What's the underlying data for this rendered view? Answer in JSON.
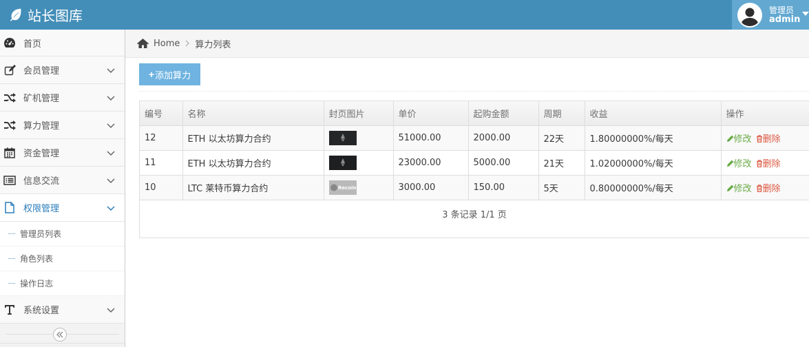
{
  "header": {
    "brand_title": "站长图库",
    "user_role": "管理员",
    "user_name": "admin"
  },
  "sidebar": {
    "items": [
      {
        "label": "首页",
        "icon": "dashboard-icon"
      },
      {
        "label": "会员管理",
        "icon": "edit-icon"
      },
      {
        "label": "矿机管理",
        "icon": "shuffle-icon"
      },
      {
        "label": "算力管理",
        "icon": "shuffle-icon"
      },
      {
        "label": "资金管理",
        "icon": "calendar-icon"
      },
      {
        "label": "信息交流",
        "icon": "list-alt-icon"
      },
      {
        "label": "权限管理",
        "icon": "file-icon"
      },
      {
        "label": "系统设置",
        "icon": "text-t-icon"
      }
    ],
    "sub_items": [
      "管理员列表",
      "角色列表",
      "操作日志"
    ]
  },
  "breadcrumb": {
    "home": "Home",
    "current": "算力列表"
  },
  "toolbar": {
    "add_label": "添加算力"
  },
  "table": {
    "headers": [
      "编号",
      "名称",
      "封页图片",
      "单价",
      "起购金额",
      "周期",
      "收益",
      "操作"
    ],
    "rows": [
      {
        "id": "12",
        "name": "ETH 以太坊算力合约",
        "price": "51000.00",
        "min": "2000.00",
        "period": "22天",
        "yield": "1.80000000%/每天",
        "thumb": "dark"
      },
      {
        "id": "11",
        "name": "ETH 以太坊算力合约",
        "price": "23000.00",
        "min": "5000.00",
        "period": "21天",
        "yield": "1.02000000%/每天",
        "thumb": "dark"
      },
      {
        "id": "10",
        "name": "LTC 莱特币算力合约",
        "price": "3000.00",
        "min": "150.00",
        "period": "5天",
        "yield": "0.80000000%/每天",
        "thumb": "light"
      }
    ],
    "edit_label": "修改",
    "delete_label": "删除",
    "pager": "3 条记录 1/1 页"
  },
  "thumb_labels": {
    "light": "Recoin"
  },
  "colors": {
    "header": "#438eb9",
    "user_box": "#62a8d1",
    "active_menu": "#2b7dbc",
    "add_button": "#6fb3e0",
    "edit": "#69aa46",
    "delete": "#dd5a43"
  }
}
